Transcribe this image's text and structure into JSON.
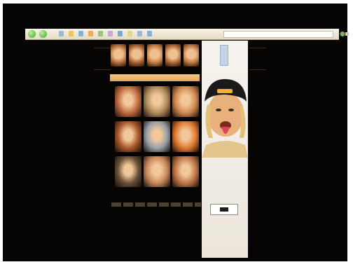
{
  "browser": {
    "back_icon": "back-arrow-icon",
    "forward_icon": "forward-arrow-icon",
    "toolbar_icon_colors": [
      "#9fb6d8",
      "#f2c25c",
      "#8ab0d4",
      "#f0a860",
      "#9cc088",
      "#c8a8d8",
      "#7fa6cc",
      "#e7d38a",
      "#9fb6d8",
      "#8ab0d4"
    ]
  },
  "page": {
    "banner_thumb_colors": [
      "#b06a38",
      "#a5602f",
      "#c07a40",
      "#ad6532",
      "#b8743c"
    ],
    "section_band_label": "",
    "gallery_tiles": [
      {
        "name": "portrait-tongue",
        "color": "#c06a40"
      },
      {
        "name": "portrait-grin",
        "color": "#b08a5c"
      },
      {
        "name": "portrait-closeup",
        "color": "#d08850"
      },
      {
        "name": "portrait-sunglasses",
        "color": "#a8582c"
      },
      {
        "name": "portrait-bw",
        "color": "#9aa0a8"
      },
      {
        "name": "portrait-orange",
        "color": "#e07a30"
      },
      {
        "name": "portrait-dark",
        "color": "#6a5038"
      },
      {
        "name": "portrait-smirk",
        "color": "#c8885a"
      },
      {
        "name": "portrait-tan",
        "color": "#c07848"
      }
    ],
    "caption": "",
    "side_panel": {
      "hero": "man-with-cap-tongue-out",
      "accent": "#f2b13c"
    }
  }
}
